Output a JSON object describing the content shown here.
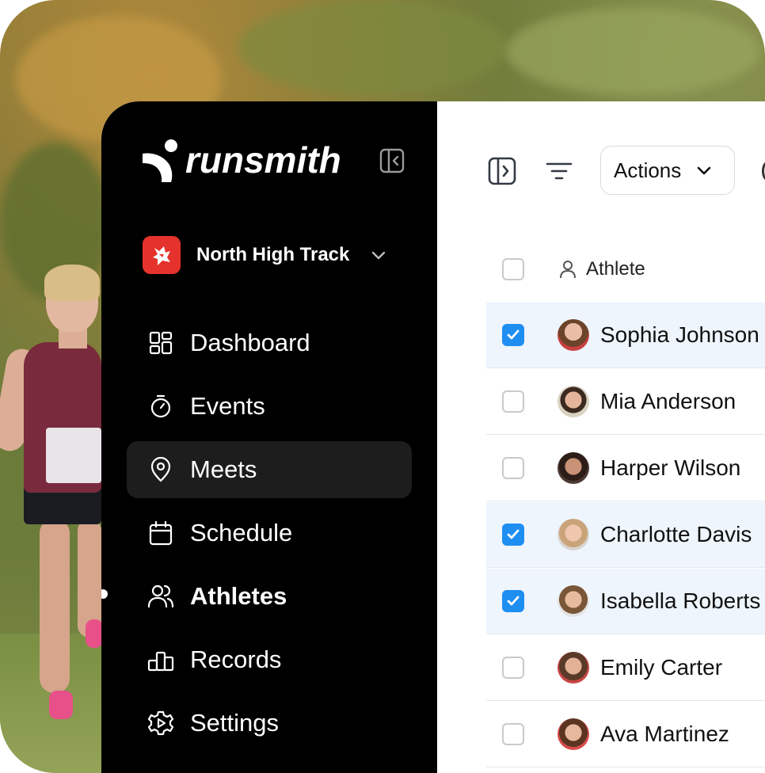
{
  "brand": {
    "name": "runsmith",
    "logo_icon": "runsmith-logo-icon"
  },
  "team": {
    "name": "North High Track",
    "logo_icon": "team-mascot-icon"
  },
  "nav": [
    {
      "label": "Dashboard",
      "icon": "grid-icon",
      "active": false
    },
    {
      "label": "Events",
      "icon": "stopwatch-icon",
      "active": false
    },
    {
      "label": "Meets",
      "icon": "location-pin-icon",
      "active": true
    },
    {
      "label": "Schedule",
      "icon": "calendar-icon",
      "active": false
    },
    {
      "label": "Athletes",
      "icon": "users-icon",
      "active": false,
      "current": true
    },
    {
      "label": "Records",
      "icon": "podium-icon",
      "active": false
    },
    {
      "label": "Settings",
      "icon": "gear-icon",
      "active": false
    }
  ],
  "toolbar": {
    "actions_label": "Actions"
  },
  "table": {
    "header": {
      "column_label": "Athlete"
    },
    "rows": [
      {
        "name": "Sophia Johnson",
        "checked": true
      },
      {
        "name": "Mia Anderson",
        "checked": false
      },
      {
        "name": "Harper Wilson",
        "checked": false
      },
      {
        "name": "Charlotte Davis",
        "checked": true
      },
      {
        "name": "Isabella Roberts",
        "checked": true
      },
      {
        "name": "Emily Carter",
        "checked": false
      },
      {
        "name": "Ava Martinez",
        "checked": false
      }
    ]
  },
  "colors": {
    "accent": "#1f8ef1",
    "sidebar_bg": "#000000",
    "selected_row_bg": "#eef5fd",
    "team_logo_bg": "#e5322d"
  }
}
